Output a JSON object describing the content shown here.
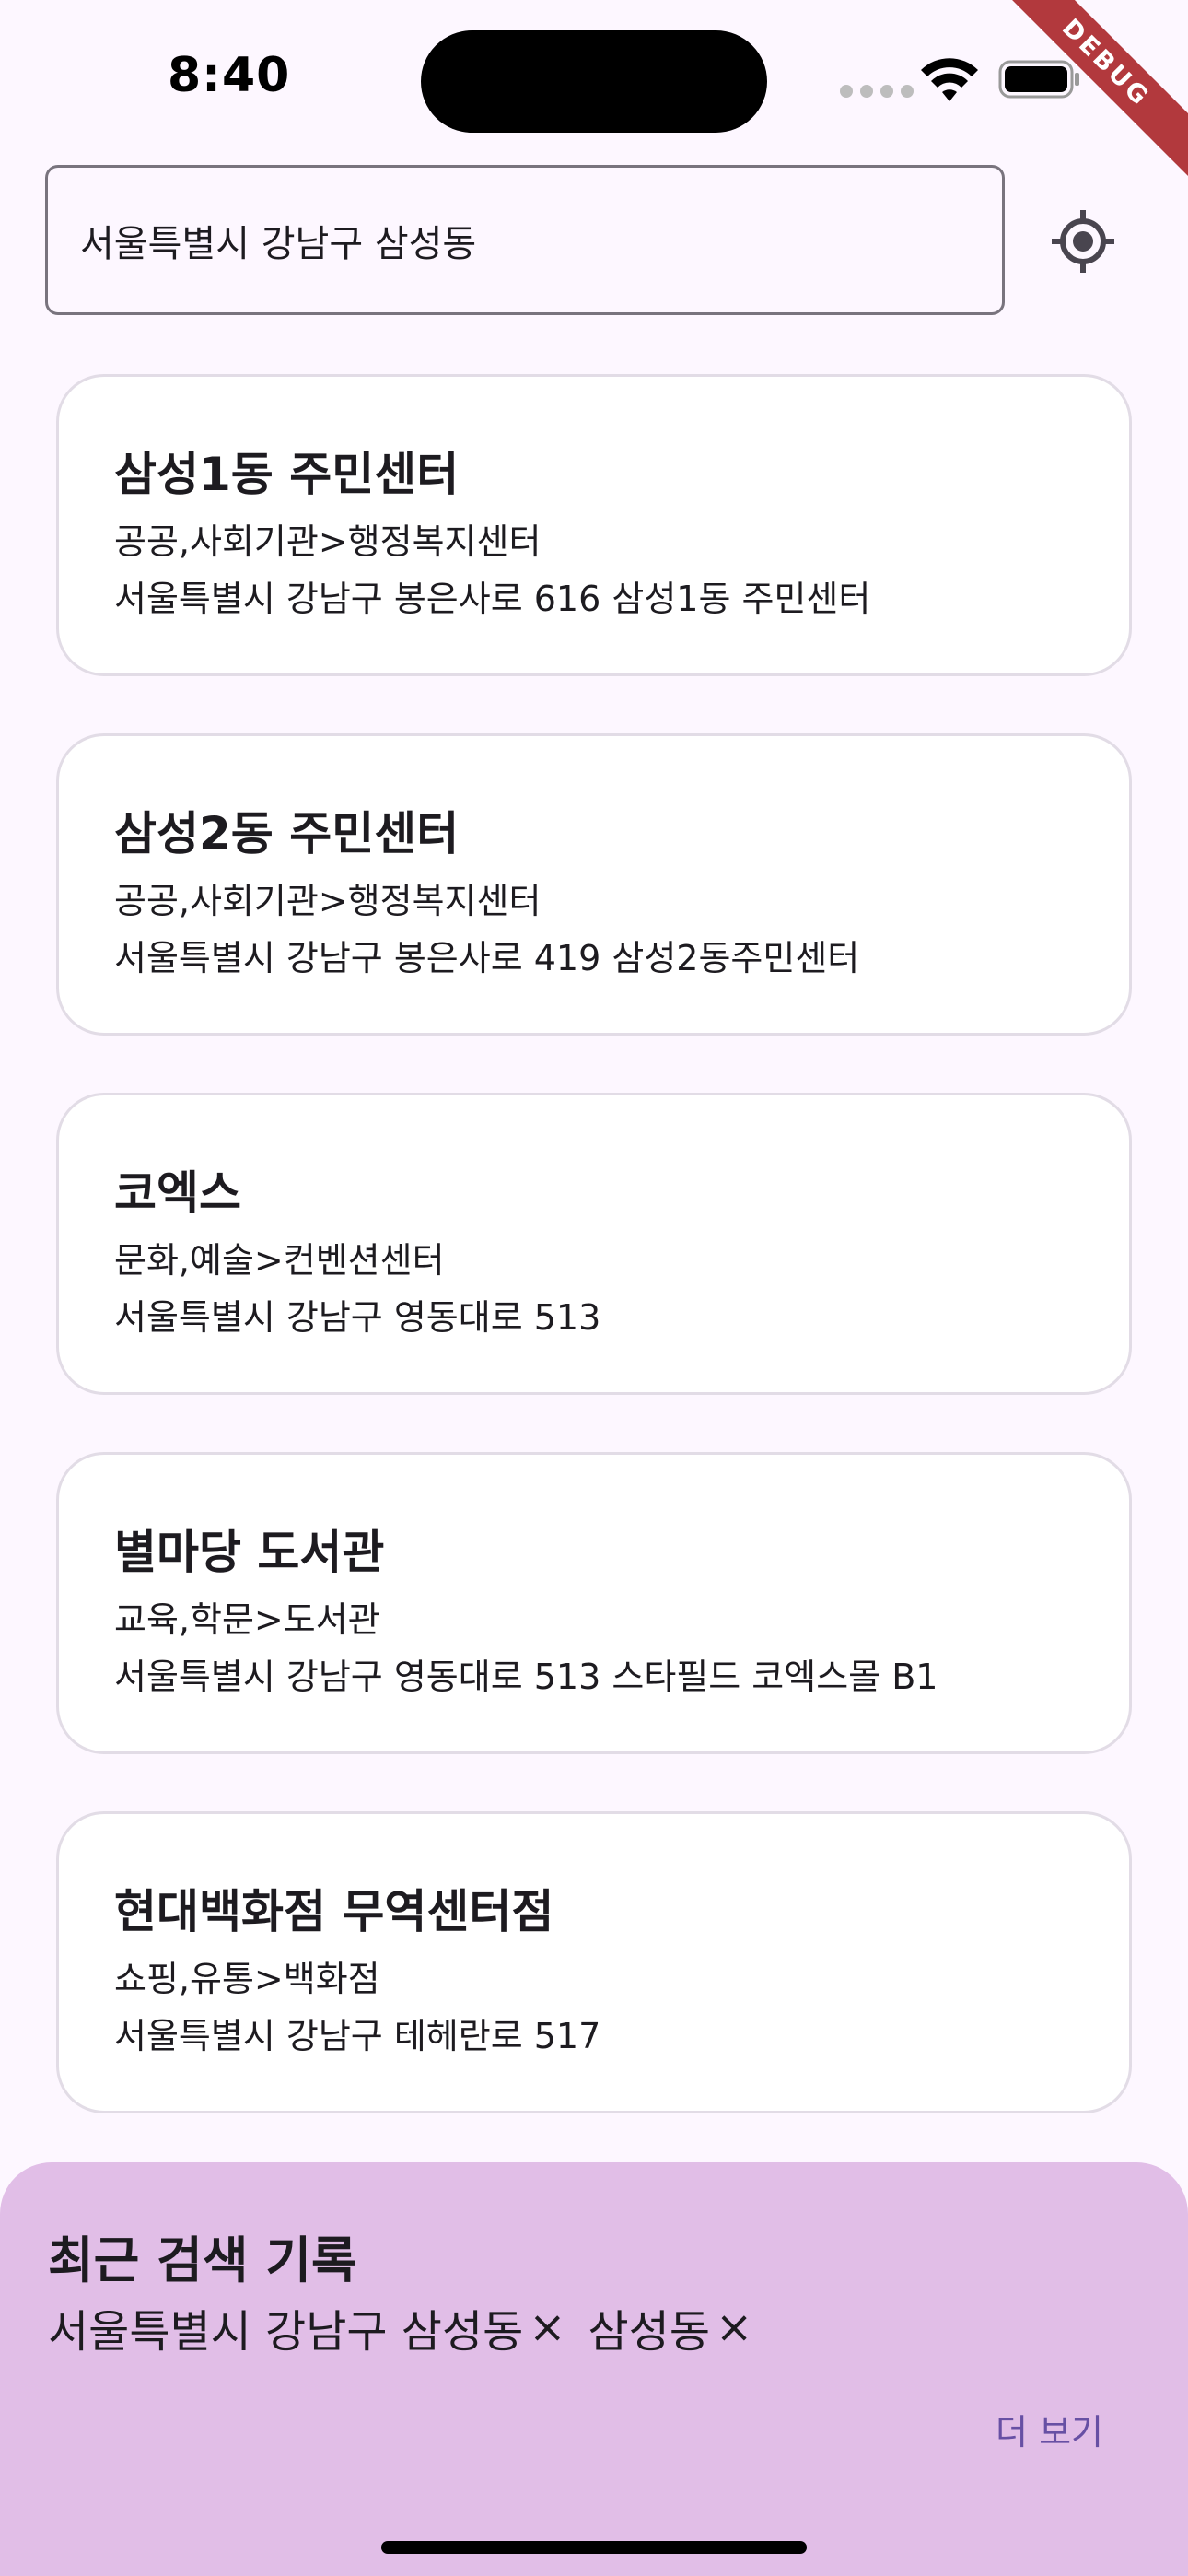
{
  "status_bar": {
    "time": "8:40",
    "debug_label": "DEBUG"
  },
  "search": {
    "value": "서울특별시 강남구 삼성동"
  },
  "results": [
    {
      "name": "삼성1동 주민센터",
      "category": "공공,사회기관>행정복지센터",
      "address": "서울특별시 강남구 봉은사로 616 삼성1동 주민센터"
    },
    {
      "name": "삼성2동 주민센터",
      "category": "공공,사회기관>행정복지센터",
      "address": "서울특별시 강남구 봉은사로 419 삼성2동주민센터"
    },
    {
      "name": "코엑스",
      "category": "문화,예술>컨벤션센터",
      "address": "서울특별시 강남구 영동대로 513"
    },
    {
      "name": "별마당 도서관",
      "category": "교육,학문>도서관",
      "address": "서울특별시 강남구 영동대로 513 스타필드 코엑스몰 B1"
    },
    {
      "name": "현대백화점 무역센터점",
      "category": "쇼핑,유통>백화점",
      "address": "서울특별시 강남구 테헤란로 517"
    }
  ],
  "recent": {
    "title": "최근 검색 기록",
    "items": [
      {
        "label": "서울특별시 강남구 삼성동",
        "remove": "×"
      },
      {
        "label": "삼성동",
        "remove": "×"
      }
    ],
    "more_label": "더 보기"
  },
  "colors": {
    "background": "#FDF7FF",
    "card": "#FFFFFF",
    "panel": "#E1BEE7",
    "accent": "#6750A4",
    "debug_ribbon": "#B2393D"
  },
  "icons": [
    "wifi-icon",
    "battery-icon",
    "my-location-icon"
  ]
}
